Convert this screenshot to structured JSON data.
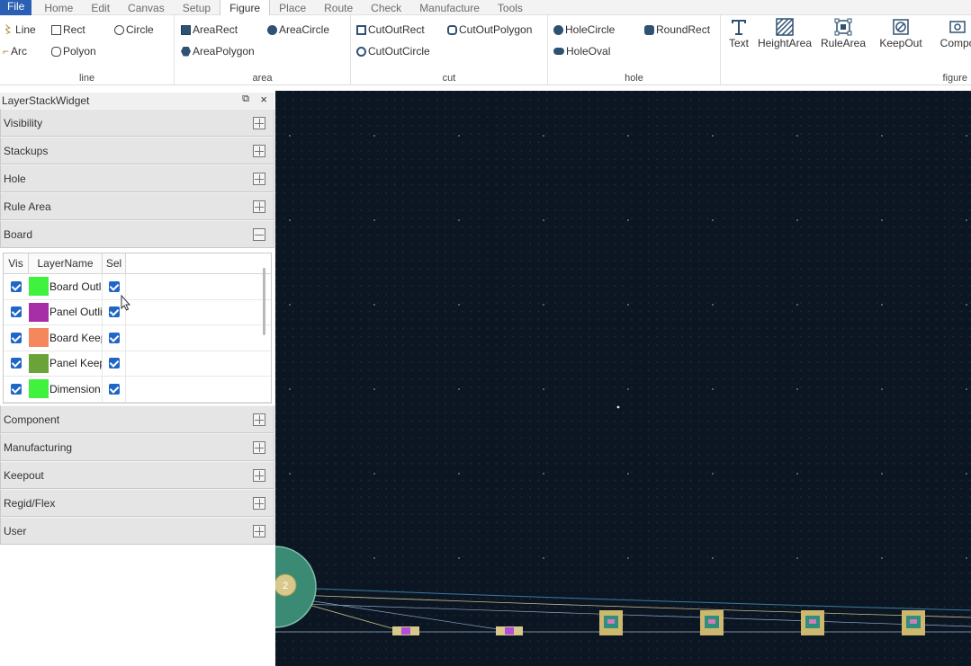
{
  "menu": {
    "file": "File",
    "items": [
      "Home",
      "Edit",
      "Canvas",
      "Setup",
      "Figure",
      "Place",
      "Route",
      "Check",
      "Manufacture",
      "Tools"
    ],
    "active": "Figure"
  },
  "ribbon": {
    "line": {
      "label": "line",
      "line": "Line",
      "rect": "Rect",
      "circle": "Circle",
      "arc": "Arc",
      "polyon": "Polyon"
    },
    "area": {
      "label": "area",
      "area_rect": "AreaRect",
      "area_circle": "AreaCircle",
      "area_polygon": "AreaPolygon"
    },
    "cut": {
      "label": "cut",
      "cut_out_rect": "CutOutRect",
      "cut_out_polygon": "CutOutPolygon",
      "cut_out_circle": "CutOutCircle"
    },
    "hole": {
      "label": "hole",
      "hole_circle": "HoleCircle",
      "round_rect": "RoundRect",
      "hole_oval": "HoleOval"
    },
    "figure": {
      "label": "figure",
      "text": "Text",
      "height_area": "HeightArea",
      "rule_area": "RuleArea",
      "keep_out": "KeepOut",
      "component": "Compo"
    }
  },
  "panel": {
    "title": "LayerStackWidget",
    "float_icon": "⧉",
    "close_icon": "×",
    "sections_top": [
      "Visibility",
      "Stackups",
      "Hole",
      "Rule Area"
    ],
    "board_section": "Board",
    "sections_bottom": [
      "Component",
      "Manufacturing",
      "Keepout",
      "Regid/Flex",
      "User"
    ],
    "table": {
      "headers": [
        "Vis",
        "LayerName",
        "Sel"
      ],
      "rows": [
        {
          "name": "Board Outline",
          "color": "#3ef23e"
        },
        {
          "name": "Panel Outline",
          "color": "#a62ea6"
        },
        {
          "name": "Board Keepout",
          "color": "#f5875c"
        },
        {
          "name": "Panel Keepout",
          "color": "#6aa338"
        },
        {
          "name": "Dimension",
          "color": "#3ef23e"
        }
      ]
    }
  },
  "canvas": {
    "background": "#0c1622",
    "grid_color": "#1e3346",
    "pad_label": "2"
  }
}
